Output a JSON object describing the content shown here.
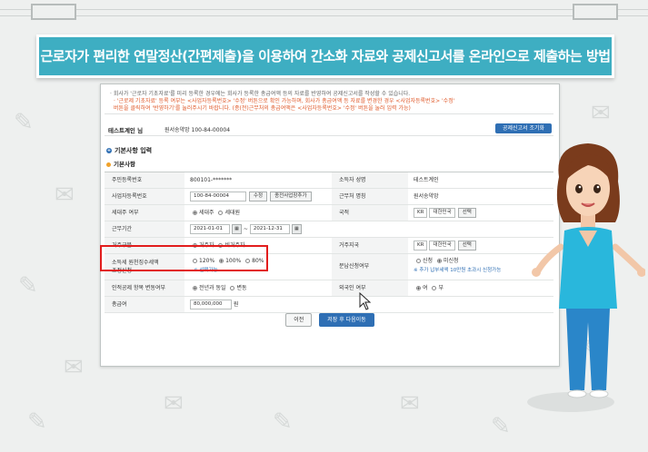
{
  "title": "근로자가 편리한 연말정산(간편제출)을 이용하여 간소화 자료와 공제신고서를 온라인으로 제출하는 방법",
  "notice": {
    "line1": "· 회사가 '근로자 기초자료'를 미리 등록한 경우에는 회사가 등록한 총급여액 등의 자료를 반영하여 공제신고서를 작성할 수 있습니다.",
    "line2": "· '근로제 기초자료' 등록 여부는 <사업자등록번호> '수정' 버튼으로 확인 가능하며, 회사가 총급여액 등 자료를 변경한 경우 <사업자등록번호> '수정'",
    "line3": "  버튼을 클릭하여 '반영하기'를 눌러주시기 바랍니다. (종(전)근무처의 총급여액은 <사업자등록번호> '수정' 버튼을 눌러 입력 가능)"
  },
  "company": {
    "name": "테스트계인 님",
    "info": "원서송약망 100-84-00004",
    "button": "공제신고서 조기화"
  },
  "section_title": "기본사항 입력",
  "subsection_title": "기본사항",
  "form": {
    "resident_label": "주민등록번호",
    "resident_value": "800101-*******",
    "company_name_label": "소득자 성명",
    "company_name_value": "테스트계인",
    "bizno_label": "사업자등록번호",
    "bizno_value": "100-84-00004",
    "bizno_edit": "수정",
    "bizno_prev": "종전사업장추가",
    "workplace_label": "근무처 명칭",
    "workplace_value": "원서송약망",
    "household_label": "세대주 여부",
    "household_opt1": "세대주",
    "household_opt2": "세대원",
    "nationality_label": "국적",
    "nationality_code": "KR",
    "nationality_name": "대한민국",
    "nationality_select": "선택",
    "period_label": "근무기간",
    "period_start": "2021-01-01",
    "period_sep": "~",
    "period_end": "2021-12-31",
    "calendar": "▦",
    "resident_type_label": "거주구분",
    "resident_type_opt1": "거주자",
    "resident_type_opt2": "비거주자",
    "residence_country_label": "거주지국",
    "residence_country_code": "KR",
    "residence_country_name": "대한민국",
    "residence_country_select": "선택",
    "withholding_label_1": "소득세 원천징수세액",
    "withholding_label_2": "조정신청",
    "withholding_opt1": "120%",
    "withholding_opt2": "100%",
    "withholding_opt3": "80%",
    "withholding_note": "※ 선택가능",
    "installment_label": "분납신청여부",
    "installment_opt1": "신청",
    "installment_opt2": "미신청",
    "installment_note": "※ 추가 납부세액 10만원 초과시 신청가능",
    "change_label": "인적공제 항목 변동여부",
    "change_opt1": "전년과 동일",
    "change_opt2": "변동",
    "foreign_label": "외국인 여부",
    "foreign_opt1": "여",
    "foreign_opt2": "부",
    "salary_label": "총급여",
    "salary_value": "80,000,000",
    "salary_unit": "원"
  },
  "buttons": {
    "prev": "이전",
    "next": "저장 후 다음이동"
  },
  "colors": {
    "banner": "#3eaec2",
    "primary": "#2f6fb4",
    "highlight": "#e21d1d",
    "notice_red": "#e05a2b"
  }
}
